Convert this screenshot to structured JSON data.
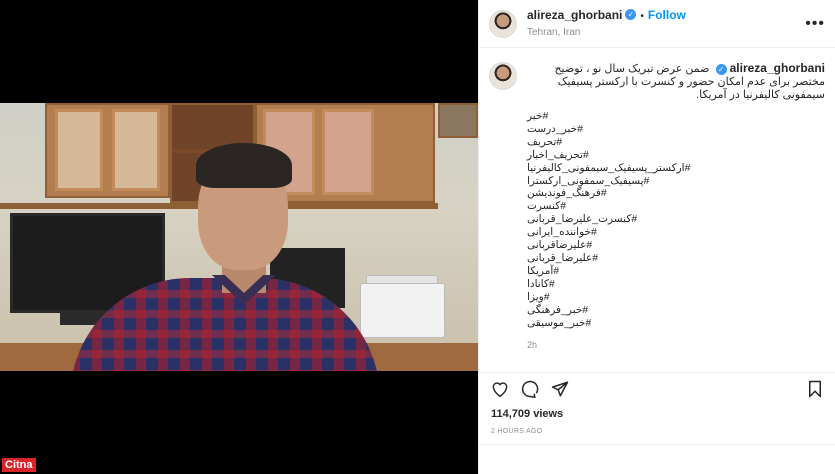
{
  "post": {
    "username": "alireza_ghorbani",
    "follow_label": "Follow",
    "location": "Tehran, Iran",
    "more_label": "•••",
    "verified_mark": "✓",
    "separator": "•"
  },
  "caption": {
    "username": "alireza_ghorbani",
    "text": "ضمن عرض تبریک سال نو ، توضیح مختصر برای عدم امکان حضور و کنسرت با ارکستر پسیفیک سیمفونی کالیفرنیا در آمریکا.",
    "hashtags": [
      "#خبر",
      "#خبر_درست",
      "#تحریف",
      "#تحریف_اخبار",
      "#ارکستر_پسیفیک_سیمفونی_کالیفرنیا",
      "#پسیفیک_سمفونی_ارکسترا",
      "#فرهنگ_فوندیشن",
      "#کنسرت",
      "#کنسرت_علیرضا_قربانی",
      "#خواننده_ایرانی",
      "#علیرضاقربانی",
      "#علیرضا_قربانی",
      "#آمریکا",
      "#کانادا",
      "#ویزا",
      "#خبر_فرهنگی",
      "#خبر_موسیقی"
    ],
    "time": "2h"
  },
  "stats": {
    "views": "114,709 views",
    "posted_ago": "2 HOURS AGO"
  },
  "watermark": "Citna",
  "icons": {
    "like": "heart-icon",
    "comment": "comment-icon",
    "share": "share-icon",
    "save": "bookmark-icon"
  },
  "colors": {
    "link_blue": "#0095f6",
    "verified_blue": "#3897f0",
    "muted": "#8e8e8e",
    "watermark_red": "#d9252a"
  }
}
